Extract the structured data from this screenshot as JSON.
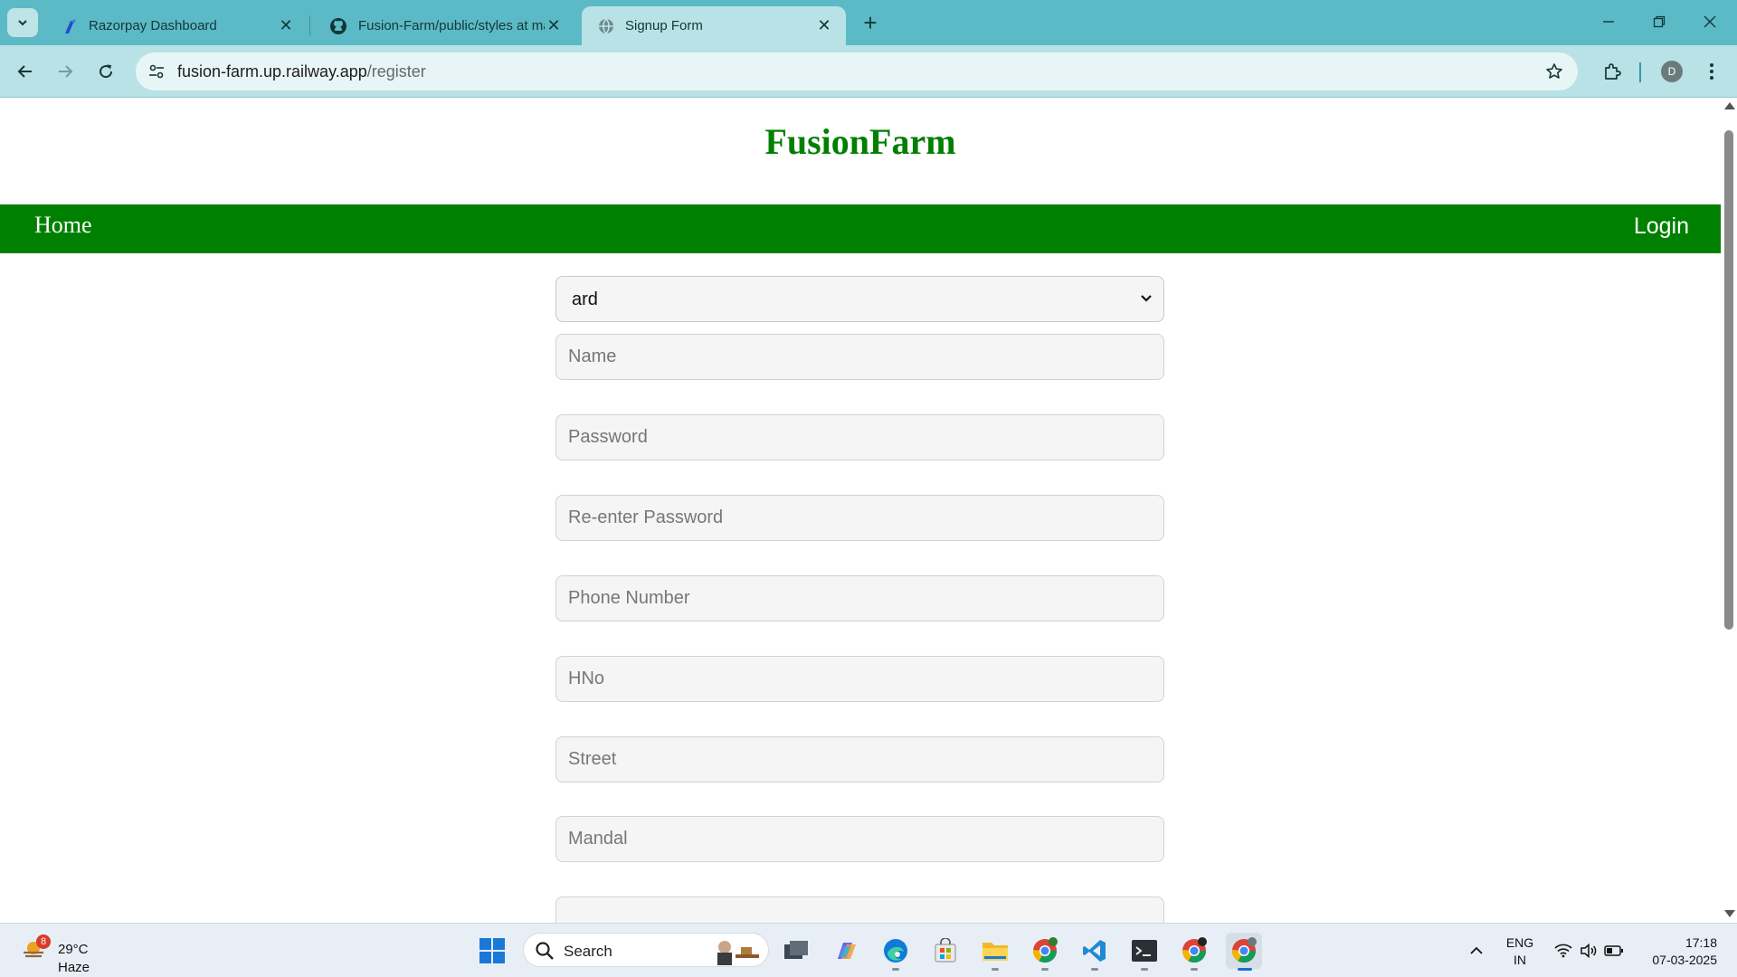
{
  "browser": {
    "tabs": [
      {
        "title": "Razorpay Dashboard",
        "active": false
      },
      {
        "title": "Fusion-Farm/public/styles at ma",
        "active": false
      },
      {
        "title": "Signup Form",
        "active": true
      }
    ],
    "url_host": "fusion-farm.up.railway.app",
    "url_path": "/register",
    "profile_initial": "D"
  },
  "page": {
    "brand": "FusionFarm",
    "nav": {
      "home": "Home",
      "login": "Login"
    },
    "form": {
      "role_select_value": "ard",
      "fields": [
        {
          "placeholder": "Name"
        },
        {
          "placeholder": "Password"
        },
        {
          "placeholder": "Re-enter Password"
        },
        {
          "placeholder": "Phone Number"
        },
        {
          "placeholder": "HNo"
        },
        {
          "placeholder": "Street"
        },
        {
          "placeholder": "Mandal"
        }
      ]
    }
  },
  "taskbar": {
    "weather": {
      "badge": "8",
      "temp": "29°C",
      "condition": "Haze"
    },
    "search_label": "Search",
    "lang_line1": "ENG",
    "lang_line2": "IN",
    "time": "17:18",
    "date": "07-03-2025"
  },
  "colors": {
    "accent_green": "#008000",
    "tabstrip": "#5bbac5",
    "toolbar": "#b8e2e6"
  }
}
